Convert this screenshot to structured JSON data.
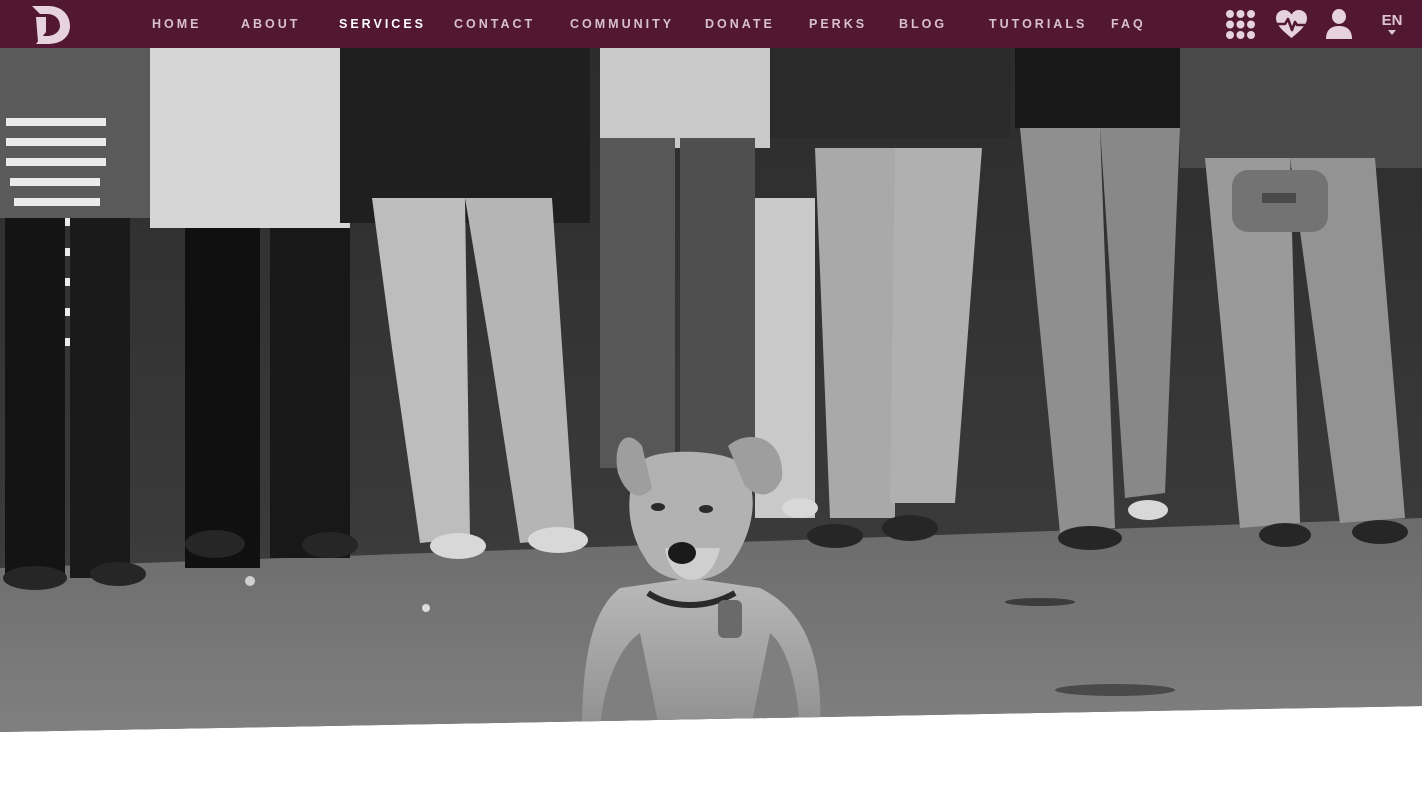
{
  "nav": {
    "items": [
      {
        "label": "HOME"
      },
      {
        "label": "ABOUT"
      },
      {
        "label": "SERVICES",
        "active": true
      },
      {
        "label": "CONTACT"
      },
      {
        "label": "COMMUNITY"
      },
      {
        "label": "DONATE"
      },
      {
        "label": "PERKS"
      },
      {
        "label": "BLOG"
      },
      {
        "label": "TUTORIALS"
      },
      {
        "label": "FAQ"
      }
    ],
    "icons": [
      "apps-grid-icon",
      "heartbeat-icon",
      "user-icon"
    ],
    "language": "EN"
  },
  "colors": {
    "navbar_bg": "#521833",
    "nav_text": "#d8c1cc",
    "nav_text_active": "#ffffff",
    "icon": "#e6d2dc"
  },
  "hero": {
    "image": "black-and-white photo of a dog lying on the street in front of a line of people with linked arms"
  }
}
